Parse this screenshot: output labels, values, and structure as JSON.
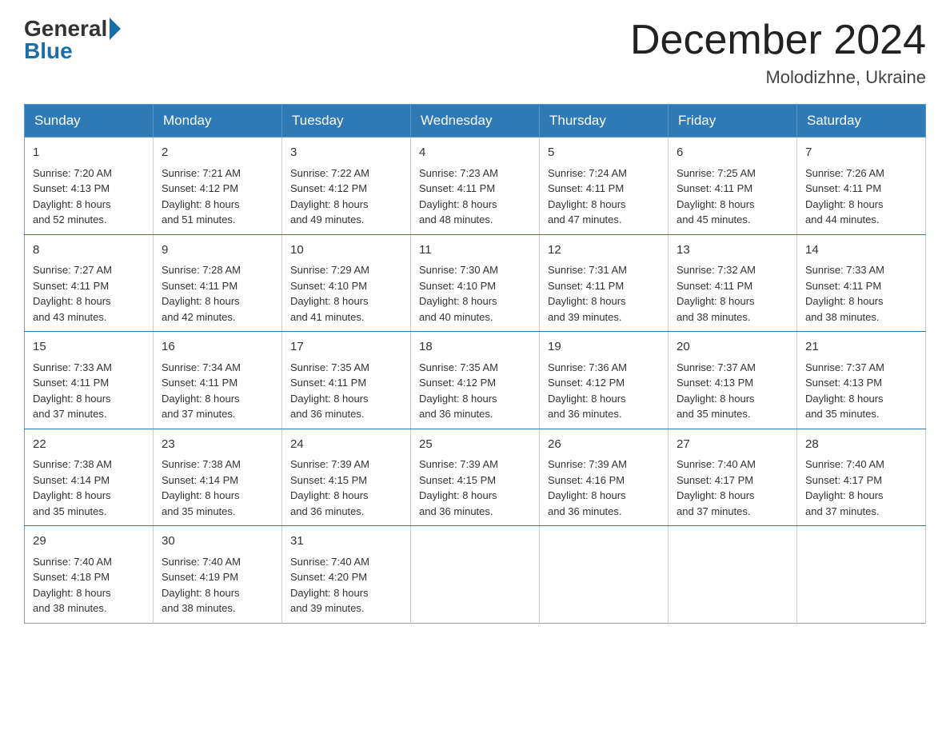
{
  "header": {
    "logo_general": "General",
    "logo_blue": "Blue",
    "month_year": "December 2024",
    "location": "Molodizhne, Ukraine"
  },
  "days_of_week": [
    "Sunday",
    "Monday",
    "Tuesday",
    "Wednesday",
    "Thursday",
    "Friday",
    "Saturday"
  ],
  "weeks": [
    [
      {
        "day": "1",
        "sunrise": "7:20 AM",
        "sunset": "4:13 PM",
        "daylight": "8 hours and 52 minutes."
      },
      {
        "day": "2",
        "sunrise": "7:21 AM",
        "sunset": "4:12 PM",
        "daylight": "8 hours and 51 minutes."
      },
      {
        "day": "3",
        "sunrise": "7:22 AM",
        "sunset": "4:12 PM",
        "daylight": "8 hours and 49 minutes."
      },
      {
        "day": "4",
        "sunrise": "7:23 AM",
        "sunset": "4:11 PM",
        "daylight": "8 hours and 48 minutes."
      },
      {
        "day": "5",
        "sunrise": "7:24 AM",
        "sunset": "4:11 PM",
        "daylight": "8 hours and 47 minutes."
      },
      {
        "day": "6",
        "sunrise": "7:25 AM",
        "sunset": "4:11 PM",
        "daylight": "8 hours and 45 minutes."
      },
      {
        "day": "7",
        "sunrise": "7:26 AM",
        "sunset": "4:11 PM",
        "daylight": "8 hours and 44 minutes."
      }
    ],
    [
      {
        "day": "8",
        "sunrise": "7:27 AM",
        "sunset": "4:11 PM",
        "daylight": "8 hours and 43 minutes."
      },
      {
        "day": "9",
        "sunrise": "7:28 AM",
        "sunset": "4:11 PM",
        "daylight": "8 hours and 42 minutes."
      },
      {
        "day": "10",
        "sunrise": "7:29 AM",
        "sunset": "4:10 PM",
        "daylight": "8 hours and 41 minutes."
      },
      {
        "day": "11",
        "sunrise": "7:30 AM",
        "sunset": "4:10 PM",
        "daylight": "8 hours and 40 minutes."
      },
      {
        "day": "12",
        "sunrise": "7:31 AM",
        "sunset": "4:11 PM",
        "daylight": "8 hours and 39 minutes."
      },
      {
        "day": "13",
        "sunrise": "7:32 AM",
        "sunset": "4:11 PM",
        "daylight": "8 hours and 38 minutes."
      },
      {
        "day": "14",
        "sunrise": "7:33 AM",
        "sunset": "4:11 PM",
        "daylight": "8 hours and 38 minutes."
      }
    ],
    [
      {
        "day": "15",
        "sunrise": "7:33 AM",
        "sunset": "4:11 PM",
        "daylight": "8 hours and 37 minutes."
      },
      {
        "day": "16",
        "sunrise": "7:34 AM",
        "sunset": "4:11 PM",
        "daylight": "8 hours and 37 minutes."
      },
      {
        "day": "17",
        "sunrise": "7:35 AM",
        "sunset": "4:11 PM",
        "daylight": "8 hours and 36 minutes."
      },
      {
        "day": "18",
        "sunrise": "7:35 AM",
        "sunset": "4:12 PM",
        "daylight": "8 hours and 36 minutes."
      },
      {
        "day": "19",
        "sunrise": "7:36 AM",
        "sunset": "4:12 PM",
        "daylight": "8 hours and 36 minutes."
      },
      {
        "day": "20",
        "sunrise": "7:37 AM",
        "sunset": "4:13 PM",
        "daylight": "8 hours and 35 minutes."
      },
      {
        "day": "21",
        "sunrise": "7:37 AM",
        "sunset": "4:13 PM",
        "daylight": "8 hours and 35 minutes."
      }
    ],
    [
      {
        "day": "22",
        "sunrise": "7:38 AM",
        "sunset": "4:14 PM",
        "daylight": "8 hours and 35 minutes."
      },
      {
        "day": "23",
        "sunrise": "7:38 AM",
        "sunset": "4:14 PM",
        "daylight": "8 hours and 35 minutes."
      },
      {
        "day": "24",
        "sunrise": "7:39 AM",
        "sunset": "4:15 PM",
        "daylight": "8 hours and 36 minutes."
      },
      {
        "day": "25",
        "sunrise": "7:39 AM",
        "sunset": "4:15 PM",
        "daylight": "8 hours and 36 minutes."
      },
      {
        "day": "26",
        "sunrise": "7:39 AM",
        "sunset": "4:16 PM",
        "daylight": "8 hours and 36 minutes."
      },
      {
        "day": "27",
        "sunrise": "7:40 AM",
        "sunset": "4:17 PM",
        "daylight": "8 hours and 37 minutes."
      },
      {
        "day": "28",
        "sunrise": "7:40 AM",
        "sunset": "4:17 PM",
        "daylight": "8 hours and 37 minutes."
      }
    ],
    [
      {
        "day": "29",
        "sunrise": "7:40 AM",
        "sunset": "4:18 PM",
        "daylight": "8 hours and 38 minutes."
      },
      {
        "day": "30",
        "sunrise": "7:40 AM",
        "sunset": "4:19 PM",
        "daylight": "8 hours and 38 minutes."
      },
      {
        "day": "31",
        "sunrise": "7:40 AM",
        "sunset": "4:20 PM",
        "daylight": "8 hours and 39 minutes."
      },
      null,
      null,
      null,
      null
    ]
  ],
  "labels": {
    "sunrise": "Sunrise:",
    "sunset": "Sunset:",
    "daylight": "Daylight:"
  }
}
